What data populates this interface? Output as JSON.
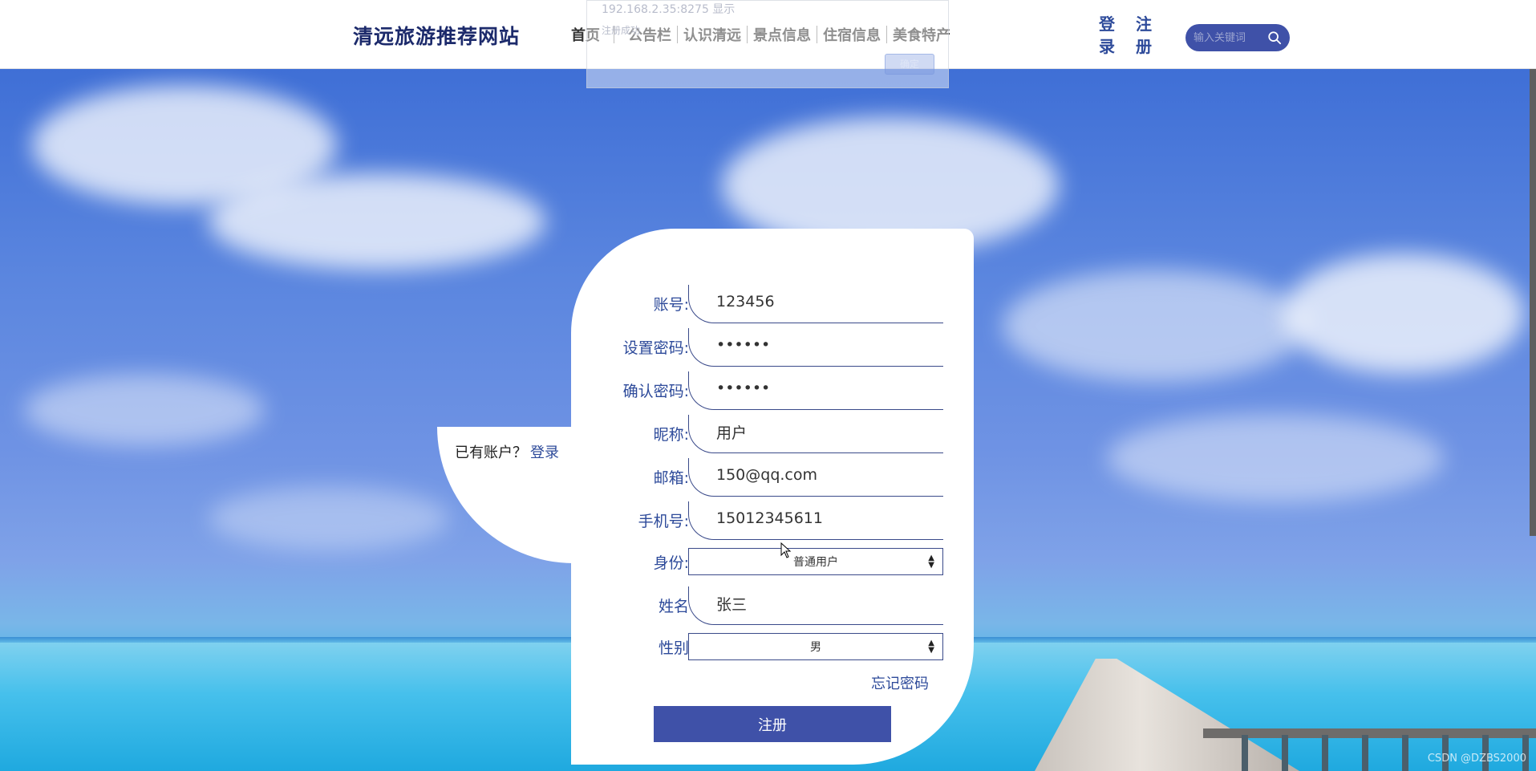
{
  "header": {
    "logo": "清远旅游推荐网站",
    "nav": [
      "首页",
      "公告栏",
      "认识清远",
      "景点信息",
      "住宿信息",
      "美食特产"
    ],
    "login": [
      "登",
      "录"
    ],
    "register": [
      "注",
      "册"
    ],
    "search_placeholder": "输入关键词"
  },
  "alert": {
    "host": "192.168.2.35:8275 显示",
    "message": "注册成功",
    "ok": "确定"
  },
  "side": {
    "prompt": "已有账户？",
    "login_link": "登录"
  },
  "form": {
    "fields": [
      {
        "label": "账号:",
        "value": "123456"
      },
      {
        "label": "设置密码:",
        "value": "••••••"
      },
      {
        "label": "确认密码:",
        "value": "••••••"
      },
      {
        "label": "昵称:",
        "value": "用户"
      },
      {
        "label": "邮箱:",
        "value": "150@qq.com"
      },
      {
        "label": "手机号:",
        "value": "15012345611"
      }
    ],
    "identity": {
      "label": "身份:",
      "value": "普通用户"
    },
    "name": {
      "label": "姓名",
      "value": "张三"
    },
    "gender": {
      "label": "性别",
      "value": "男"
    },
    "forgot": "忘记密码",
    "submit": "注册"
  },
  "watermark": "CSDN @DZBS2000",
  "colors": {
    "brand": "#3f51a8",
    "label": "#2d4a9a"
  }
}
